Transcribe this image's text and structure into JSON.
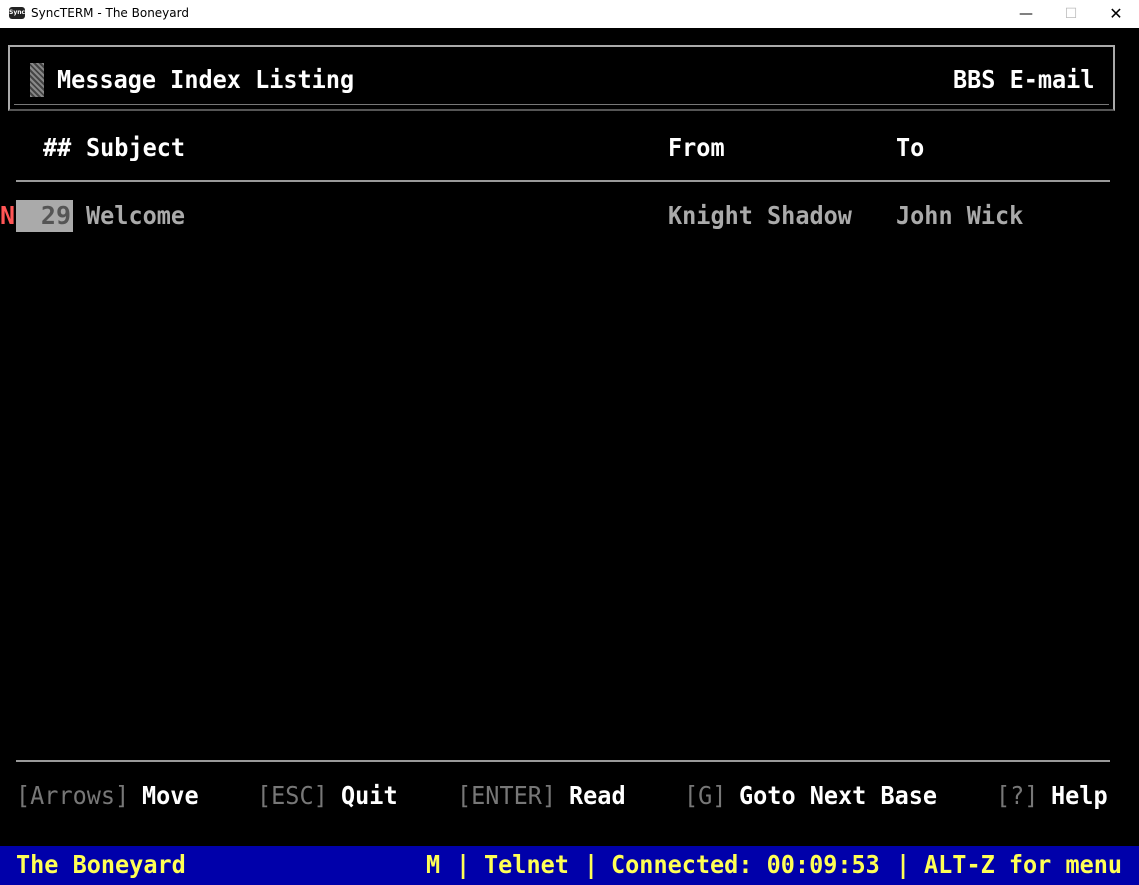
{
  "window": {
    "title": "SyncTERM - The Boneyard",
    "icon": "syncterm-icon",
    "icon_text": "Sync",
    "minimize": "—",
    "maximize": "☐",
    "close": "✕"
  },
  "header": {
    "title": "Message Index Listing",
    "right": "BBS E-mail"
  },
  "columns": {
    "num": "##",
    "subject": "Subject",
    "from": "From",
    "to": "To"
  },
  "messages": [
    {
      "flag": "N",
      "num": "29",
      "subject": "Welcome",
      "from": "Knight Shadow",
      "to": "John Wick"
    }
  ],
  "footer": {
    "arrows_key": "[Arrows]",
    "arrows_label": "Move",
    "esc_key": "[ESC]",
    "esc_label": "Quit",
    "enter_key": "[ENTER]",
    "enter_label": "Read",
    "g_key": "[G]",
    "g_label": "Goto Next Base",
    "help_key": "[?]",
    "help_label": "Help"
  },
  "status": {
    "bbs": "The Boneyard",
    "mode": "M",
    "protocol": "Telnet",
    "connected": "Connected: 00:09:53",
    "menu_hint": "ALT-Z for menu",
    "separator": "|"
  },
  "colors": {
    "background": "#000000",
    "status_bg": "#0000aa",
    "status_fg": "#ffff55",
    "new_flag": "#ff5555",
    "selected_bg": "#aaaaaa"
  }
}
